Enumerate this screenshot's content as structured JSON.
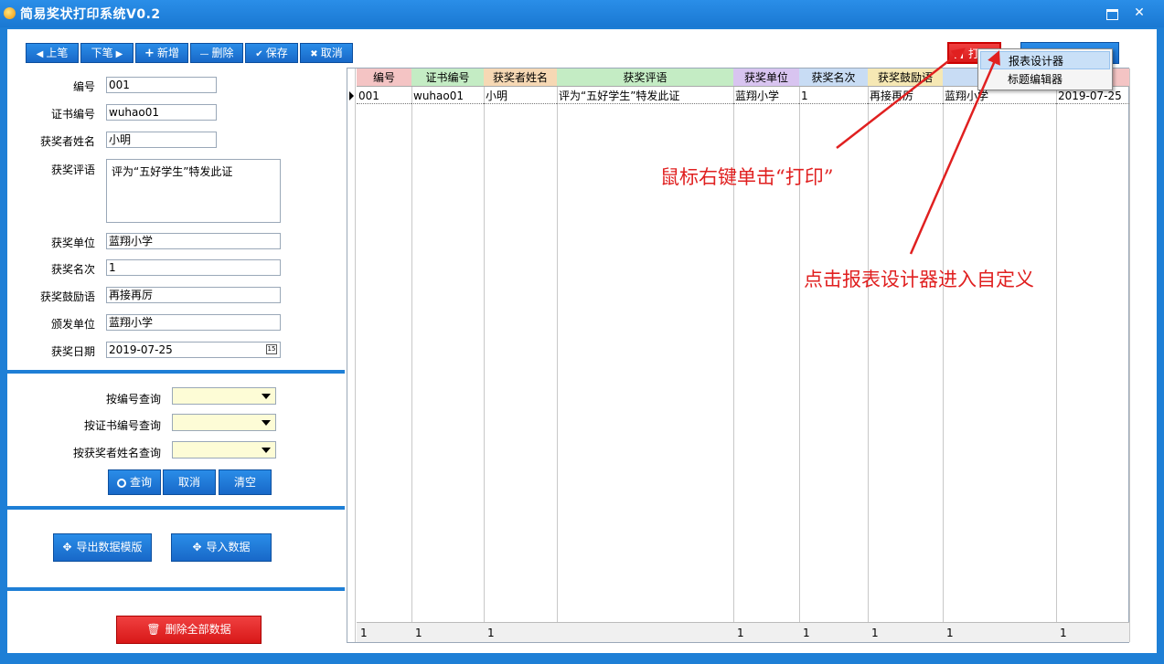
{
  "window": {
    "title": "简易奖状打印系统V0.2",
    "close_glyph": "✕"
  },
  "toolbar": {
    "prev": "上笔",
    "next": "下笔",
    "add": "新增",
    "delete": "删除",
    "save": "保存",
    "cancel": "取消",
    "print_partial": "打",
    "prev_icon": "◀",
    "next_icon": "▶",
    "add_icon": "+",
    "delete_icon": "—",
    "save_icon": "✔",
    "cancel_icon": "✖"
  },
  "form": {
    "fields": [
      {
        "label": "编号",
        "value": "001"
      },
      {
        "label": "证书编号",
        "value": "wuhao01"
      },
      {
        "label": "获奖者姓名",
        "value": "小明"
      },
      {
        "label": "获奖评语",
        "value": "评为“五好学生”特发此证"
      },
      {
        "label": "获奖单位",
        "value": "蓝翔小学"
      },
      {
        "label": "获奖名次",
        "value": "1"
      },
      {
        "label": "获奖鼓励语",
        "value": "再接再厉"
      },
      {
        "label": "颁发单位",
        "value": "蓝翔小学"
      },
      {
        "label": "获奖日期",
        "value": "2019-07-25"
      }
    ],
    "calendar_glyph": "15"
  },
  "query": {
    "by_id": "按编号查询",
    "by_cert": "按证书编号查询",
    "by_name": "按获奖者姓名查询",
    "search": "查询",
    "cancel": "取消",
    "clear": "清空"
  },
  "actions": {
    "export_template": "导出数据模版",
    "import_data": "导入数据",
    "delete_all": "删除全部数据"
  },
  "grid": {
    "headers": [
      "编号",
      "证书编号",
      "获奖者姓名",
      "获奖评语",
      "获奖单位",
      "获奖名次",
      "获奖鼓励语"
    ],
    "header_colors": [
      "#f4c4c4",
      "#c4ecc4",
      "#f6d8b4",
      "#c4ecc4",
      "#d8c4f0",
      "#c8dcf4",
      "#f6e8b4",
      "#c8dcf4",
      "#f4c4c4"
    ],
    "row": [
      "001",
      "wuhao01",
      "小明",
      "评为“五好学生”特发此证",
      "蓝翔小学",
      "1",
      "再接再厉",
      "蓝翔小学",
      "2019-07-25"
    ],
    "footer": [
      "1",
      "1",
      "1",
      "",
      "1",
      "1",
      "1",
      "1",
      "1"
    ]
  },
  "context_menu": {
    "items": [
      "报表设计器",
      "标题编辑器"
    ]
  },
  "annotations": {
    "right_click": "鼠标右键单击“打印”",
    "report_designer": "点击报表设计器进入自定义"
  },
  "colors": {
    "accent": "#1e7fd6",
    "danger": "#e02020"
  }
}
